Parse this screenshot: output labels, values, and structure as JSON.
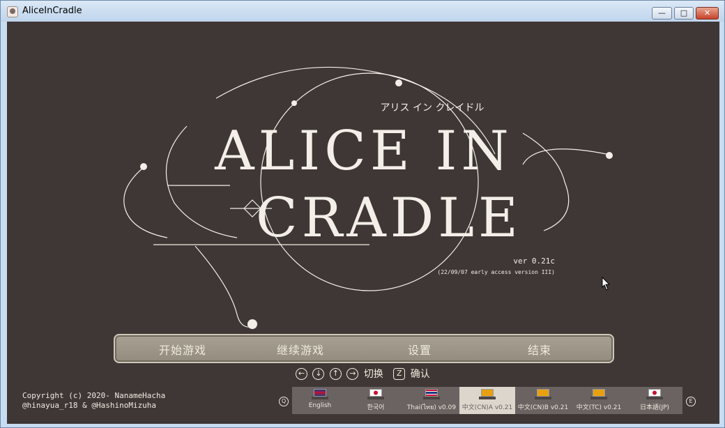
{
  "window": {
    "title": "AliceInCradle",
    "min_glyph": "—",
    "max_glyph": "□",
    "close_glyph": "✕"
  },
  "logo": {
    "line1": "ALICE IN",
    "line2": "CRADLE",
    "katakana": "アリス イン クレイドル",
    "version": "ver 0.21c",
    "build_note": "(22/09/07 early access version III)"
  },
  "menu": {
    "items": [
      "开始游戏",
      "继续游戏",
      "设置",
      "结束"
    ]
  },
  "controls": {
    "arrow_keys": [
      "←",
      "↓",
      "↑",
      "→"
    ],
    "switch_label": "切换",
    "confirm_key": "Z",
    "confirm_label": "确认"
  },
  "copyright": {
    "line1": "Copyright (c) 2020- NanameHacha",
    "line2": "@hinayua_r18 & @HashinoMizuha"
  },
  "languages": {
    "prev_key": "Q",
    "next_key": "E",
    "items": [
      {
        "label": "English"
      },
      {
        "label": "한국어"
      },
      {
        "label": "Thai(ไทย) v0.09"
      },
      {
        "label": "中文(CN)A v0.21"
      },
      {
        "label": "中文(CN)B v0.21"
      },
      {
        "label": "中文(TC) v0.21"
      },
      {
        "label": "日本語(JP)"
      }
    ],
    "active_index": 3
  },
  "colors": {
    "background": "#3e3735",
    "logo_ink": "#f3efe8",
    "menu_bar": "#9f988a"
  }
}
